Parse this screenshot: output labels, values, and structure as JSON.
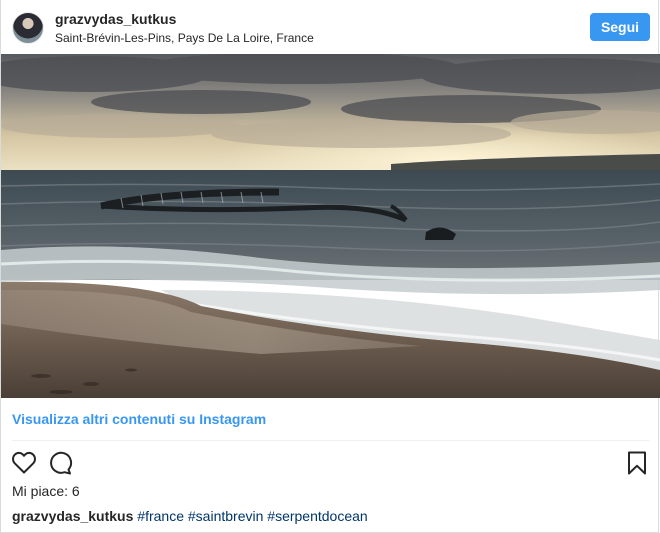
{
  "header": {
    "username": "grazvydas_kutkus",
    "location": "Saint-Brévin-Les-Pins, Pays De La Loire, France",
    "follow_label": "Segui"
  },
  "post": {
    "view_more_label": "Visualizza altri contenuti su Instagram",
    "likes_label": "Mi piace: 6",
    "caption_user": "grazvydas_kutkus",
    "hashtags": [
      "#france",
      "#saintbrevin",
      "#serpentdocean"
    ]
  },
  "icons": {
    "like": "heart-icon",
    "comment": "comment-icon",
    "save": "bookmark-icon"
  },
  "colors": {
    "accent": "#3897f0",
    "hashtag": "#003569",
    "text": "#262626",
    "border": "#dbdbdb"
  }
}
